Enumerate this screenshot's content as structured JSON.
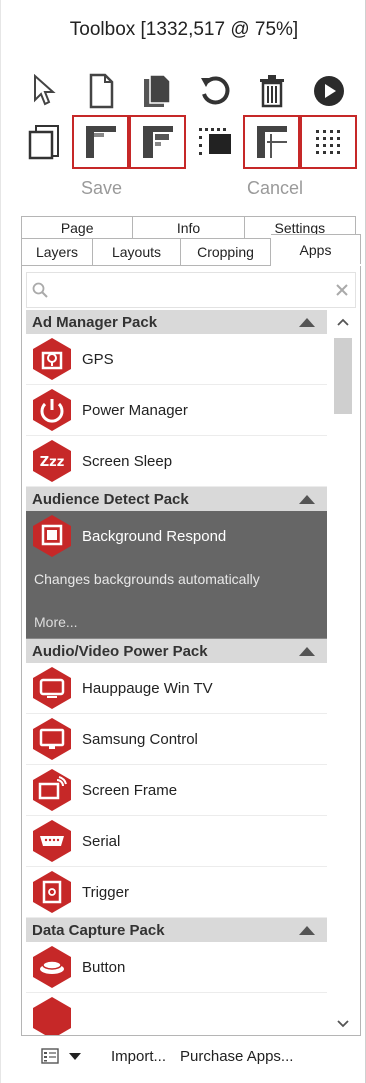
{
  "window": {
    "title": "Toolbox [1332,517 @  75%]"
  },
  "toolbar": {
    "save_label": "Save",
    "cancel_label": "Cancel"
  },
  "tabs_row1": [
    "Page",
    "Info",
    "Settings"
  ],
  "tabs_row2": [
    "Layers",
    "Layouts",
    "Cropping",
    "Apps"
  ],
  "active_tab": "Apps",
  "search": {
    "value": "",
    "placeholder": ""
  },
  "groups": [
    {
      "name": "Ad Manager Pack",
      "items": [
        "GPS",
        "Power Manager",
        "Screen Sleep"
      ]
    },
    {
      "name": "Audience Detect Pack",
      "items": [
        "Background Respond"
      ],
      "expanded_item": {
        "label": "Background Respond",
        "description": "Changes backgrounds automatically",
        "more": "More..."
      }
    },
    {
      "name": "Audio/Video Power Pack",
      "items": [
        "Hauppauge Win TV",
        "Samsung Control",
        "Screen Frame",
        "Serial",
        "Trigger"
      ]
    },
    {
      "name": "Data Capture Pack",
      "items": [
        "Button"
      ]
    }
  ],
  "footer": {
    "import_label": "Import...",
    "purchase_label": "Purchase Apps..."
  },
  "colors": {
    "accent": "#c62828",
    "group_header": "#d9d9d9",
    "expanded_bg": "#666666"
  }
}
